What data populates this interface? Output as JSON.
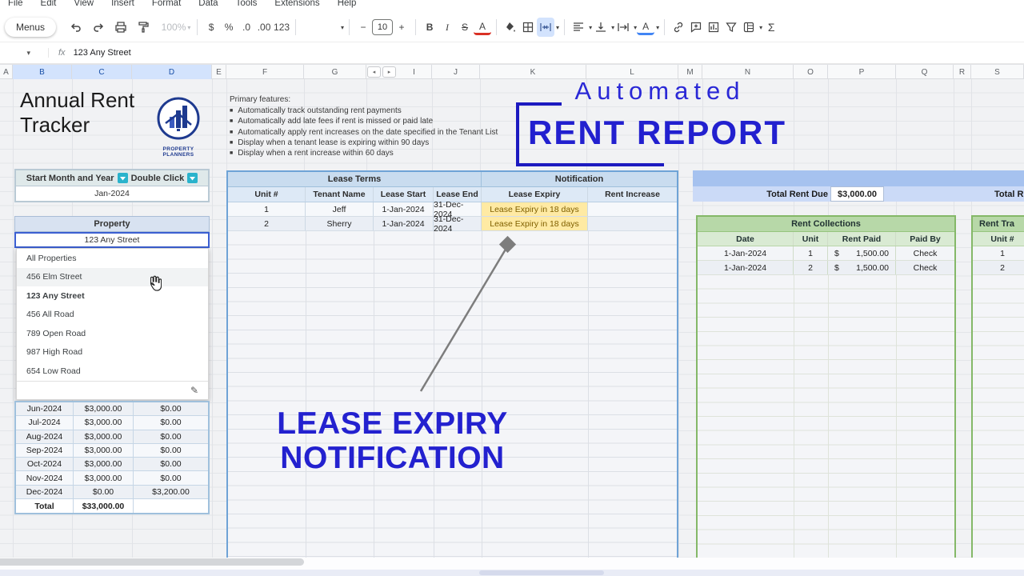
{
  "menubar": {
    "items": [
      "File",
      "Edit",
      "View",
      "Insert",
      "Format",
      "Data",
      "Tools",
      "Extensions",
      "Help"
    ]
  },
  "toolbar": {
    "menus": "Menus",
    "zoom": "100%",
    "currency": "$",
    "percent": "%",
    "dec_down": ".0",
    "dec_up": ".00",
    "num_fmt": "123",
    "minus": "−",
    "font_size": "10",
    "plus": "+",
    "bold": "B",
    "italic": "I",
    "strike": "S",
    "text_color": "A",
    "sigma": "Σ",
    "caret": "▾"
  },
  "formula_bar": {
    "caret": "▾",
    "fx": "fx",
    "value": "123 Any Street"
  },
  "columns": {
    "letters": [
      "A",
      "B",
      "C",
      "D",
      "E",
      "F",
      "G",
      "I",
      "J",
      "K",
      "L",
      "M",
      "N",
      "O",
      "P",
      "Q",
      "R",
      "S"
    ],
    "hidden_left": "◂",
    "hidden_right": "▸"
  },
  "header_block": {
    "title_line1": "Annual Rent",
    "title_line2": "Tracker",
    "logo_caption": "PROPERTY PLANNERS"
  },
  "features": {
    "heading": "Primary features:",
    "bullet": "■",
    "items": [
      "Automatically track outstanding rent payments",
      "Automatically add late fees if rent is missed or paid late",
      "Automatically apply rent increases on the date specified in the Tenant List",
      "Display when a tenant lease is expiring within 90 days",
      "Display when a rent increase within 60 days"
    ]
  },
  "start_month": {
    "label": "Start Month and Year",
    "hint": "Double Click",
    "value": "Jan-2024"
  },
  "property": {
    "header": "Property",
    "selected": "123 Any Street",
    "edit_icon": "✎",
    "options": [
      "All Properties",
      "456 Elm Street",
      "123 Any Street",
      "456 All Road",
      "789 Open Road",
      "987 High Road",
      "654 Low Road"
    ]
  },
  "monthly_table": {
    "rows": [
      [
        "Jun-2024",
        "$3,000.00",
        "$0.00"
      ],
      [
        "Jul-2024",
        "$3,000.00",
        "$0.00"
      ],
      [
        "Aug-2024",
        "$3,000.00",
        "$0.00"
      ],
      [
        "Sep-2024",
        "$3,000.00",
        "$0.00"
      ],
      [
        "Oct-2024",
        "$3,000.00",
        "$0.00"
      ],
      [
        "Nov-2024",
        "$3,000.00",
        "$0.00"
      ],
      [
        "Dec-2024",
        "$0.00",
        "$3,200.00"
      ]
    ],
    "total_row": [
      "Total",
      "$33,000.00",
      ""
    ]
  },
  "lease_table": {
    "group_left": "Lease Terms",
    "group_right": "Notification",
    "headers": [
      "Unit #",
      "Tenant Name",
      "Lease Start",
      "Lease End",
      "Lease Expiry",
      "Rent Increase"
    ],
    "rows": [
      [
        "1",
        "Jeff",
        "1-Jan-2024",
        "31-Dec-2024",
        "Lease Expiry in 18 days",
        ""
      ],
      [
        "2",
        "Sherry",
        "1-Jan-2024",
        "31-Dec-2024",
        "Lease Expiry in 18 days",
        ""
      ]
    ]
  },
  "totals_bar": {
    "label": "Total Rent Due",
    "value": "$3,000.00",
    "right_label": "Total R"
  },
  "collections_table": {
    "title": "Rent Collections",
    "headers": [
      "Date",
      "Unit",
      "Rent Paid",
      "Paid By"
    ],
    "rows": [
      [
        "1-Jan-2024",
        "1",
        "$",
        "1,500.00",
        "Check"
      ],
      [
        "1-Jan-2024",
        "2",
        "$",
        "1,500.00",
        "Check"
      ]
    ]
  },
  "right_table": {
    "title": "Rent Tra",
    "unit_header": "Unit #",
    "rows": [
      "1",
      "2"
    ]
  },
  "overlay": {
    "automated": "Automated",
    "rent_report": "RENT REPORT",
    "lease_line1": "LEASE EXPIRY",
    "lease_line2": "NOTIFICATION"
  },
  "colors": {
    "overlay_blue": "#2321cf",
    "lease_border": "#6fa3d6",
    "green_border": "#84b868",
    "yellow_bg": "#ffeaa3",
    "teal_icon": "#2ab3cc"
  }
}
